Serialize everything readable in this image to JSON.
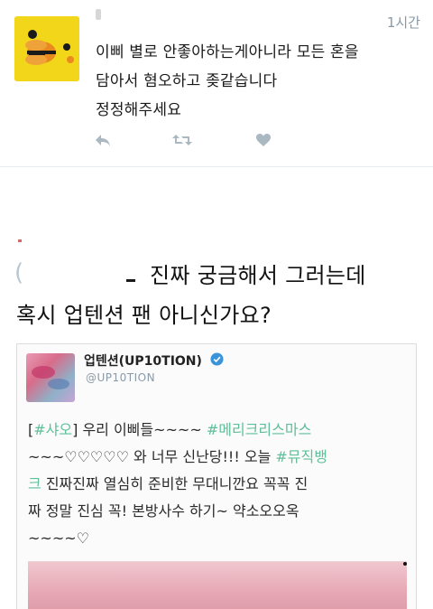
{
  "tweet": {
    "timestamp": "1시간",
    "text_lines": [
      "이삐 별로 안좋아하는게아니라 모든 혼을",
      "담아서 혐오하고 좆같습니다",
      "정정해주세요"
    ],
    "actions": {
      "reply_icon": "reply-icon",
      "retweet_icon": "retweet-icon",
      "like_icon": "heart-icon"
    }
  },
  "reply": {
    "line1": "진짜 궁금해서 그러는데",
    "line2": "혹시 업텐션 팬 아니신가요?"
  },
  "embed": {
    "name": "업텐션(UP10TION)",
    "handle": "@UP10TION",
    "lines": [
      [
        {
          "t": "[",
          "tag": false
        },
        {
          "t": "#샤오",
          "tag": true
        },
        {
          "t": "] 우리 이삐들~~~~ ",
          "tag": false
        },
        {
          "t": "#메리크리스마스",
          "tag": true
        }
      ],
      [
        {
          "t": "~~~♡♡♡♡♡ 와 너무 신난당!!! 오늘 ",
          "tag": false
        },
        {
          "t": "#뮤직뱅",
          "tag": true
        }
      ],
      [
        {
          "t": "크",
          "tag": true
        },
        {
          "t": " 진짜진짜 열심히 준비한 무대니깐요 꼭꼭 진",
          "tag": false
        }
      ],
      [
        {
          "t": "짜 정말 진심 꼭! 본방사수 하기~ 약소오오옥",
          "tag": false
        }
      ],
      [
        {
          "t": "~~~~♡",
          "tag": false
        }
      ]
    ]
  },
  "colors": {
    "tag": "#5fbf9a",
    "action_icon": "#aab8c2",
    "timestamp": "#8899a6",
    "avatar_bg": "#f1d619",
    "verified": "#3b94d9"
  }
}
